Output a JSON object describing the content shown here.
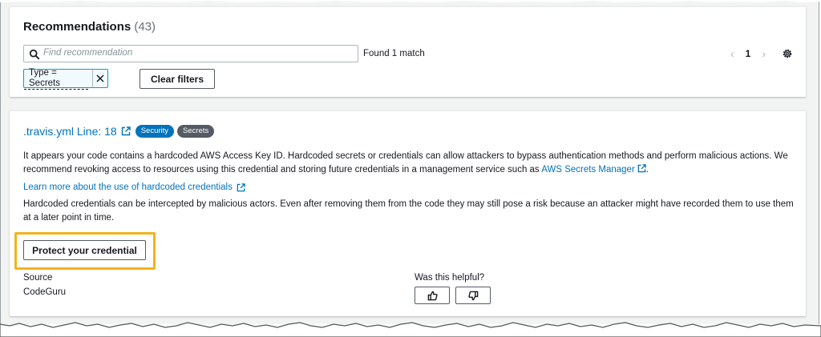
{
  "recommendations": {
    "title": "Recommendations",
    "count": "(43)",
    "search_placeholder": "Find recommendation",
    "match_text": "Found 1 match",
    "pagination": {
      "current_page": "1"
    },
    "filter_token": "Type = Secrets",
    "clear_filters_label": "Clear filters"
  },
  "finding": {
    "file_link": ".travis.yml Line: 18",
    "badges": [
      "Security",
      "Secrets"
    ],
    "description_before_link": "It appears your code contains a hardcoded AWS Access Key ID. Hardcoded secrets or credentials can allow attackers to bypass authentication methods and perform malicious actions. We recommend revoking access to resources using this credential and storing future credentials in a management service such as ",
    "description_link": "AWS Secrets Manager",
    "description_after_link": ".",
    "learn_more_link": "Learn more about the use of hardcoded credentials",
    "warning": "Hardcoded credentials can be intercepted by malicious actors. Even after removing them from the code they may still pose a risk because an attacker might have recorded them to use them at a later point in time.",
    "protect_button": "Protect your credential",
    "source_label": "Source",
    "source_value": "CodeGuru",
    "helpful_label": "Was this helpful?"
  },
  "icons": {
    "search": "search-icon",
    "remove_filter": "close-icon",
    "prev_page": "chevron-left-icon",
    "next_page": "chevron-right-icon",
    "settings": "gear-icon",
    "external_link": "external-link-icon",
    "thumbs_up": "thumbs-up-icon",
    "thumbs_down": "thumbs-down-icon"
  },
  "colors": {
    "link": "#0073bb",
    "security_badge": "#0073bb",
    "secrets_badge": "#545b64",
    "highlight": "#f2b31c",
    "filter_token_border": "#00a1c9",
    "page_background": "#f2f3f3"
  }
}
